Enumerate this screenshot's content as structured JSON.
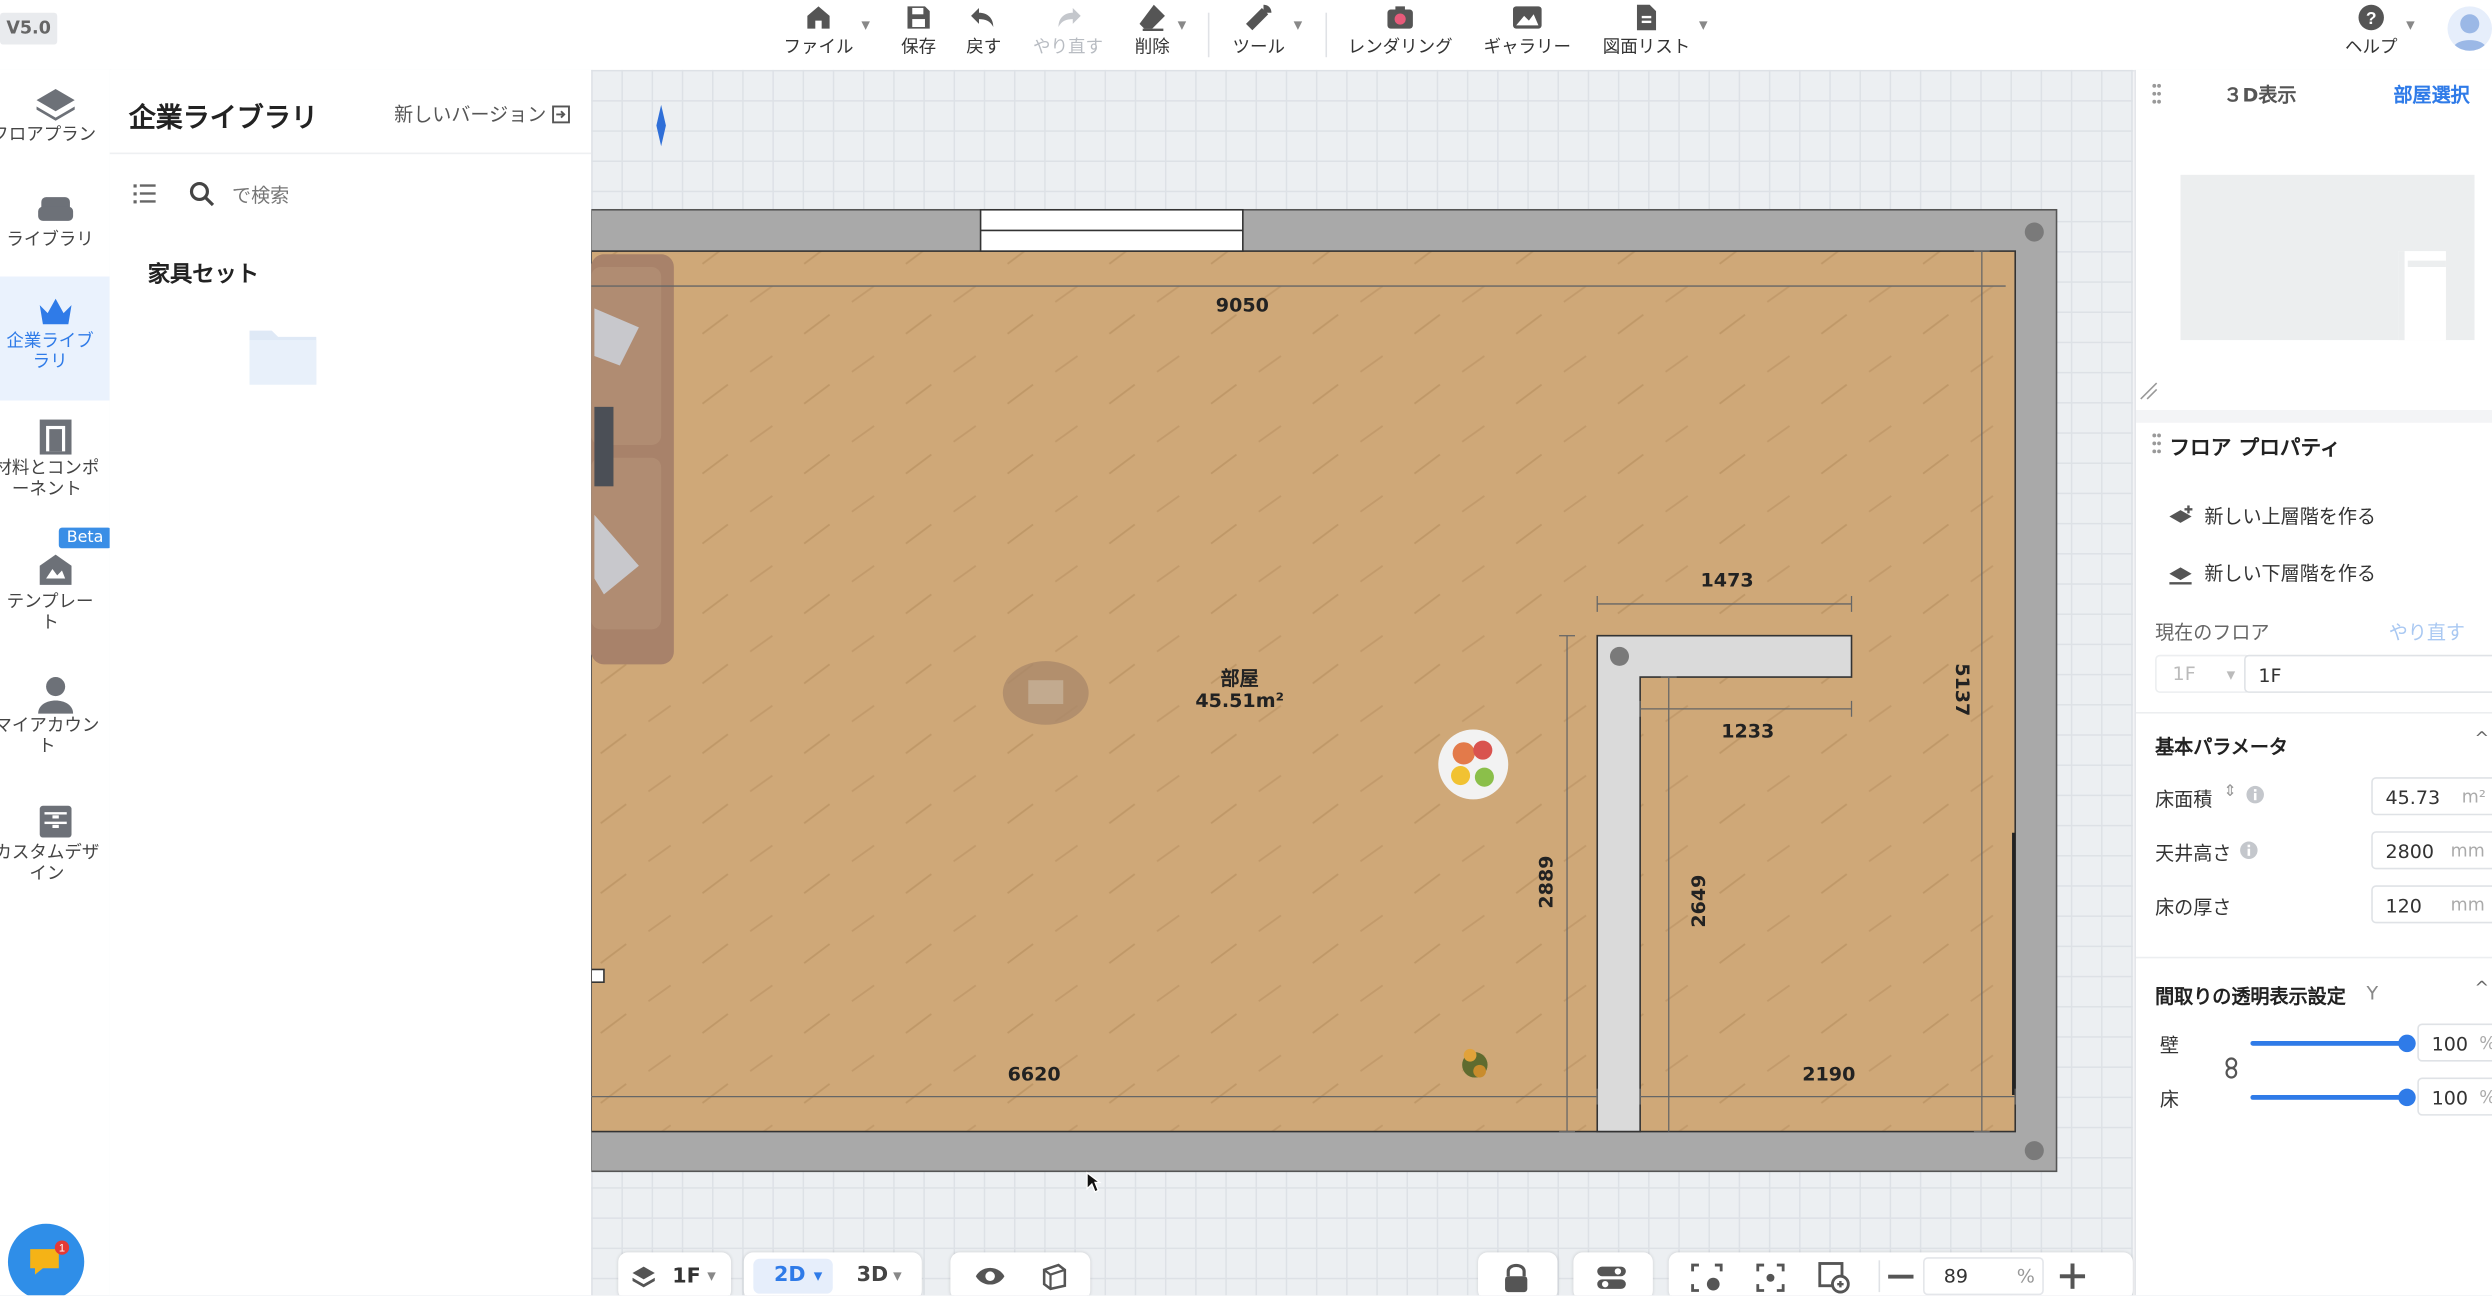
{
  "version": "V5.0",
  "toolbar": {
    "file": "ファイル",
    "save": "保存",
    "undo": "戻す",
    "redo": "やり直す",
    "delete": "削除",
    "tools": "ツール",
    "rendering": "レンダリング",
    "gallery": "ギャラリー",
    "drawing_list": "図面リスト",
    "help": "ヘルプ"
  },
  "nav": {
    "floorplan": "フロアプラン",
    "library": "ライブラリ",
    "enterprise_library": "企業ライブラリ",
    "materials": "材料とコンポーネント",
    "template": "テンプレート",
    "beta": "Beta",
    "my_account": "マイアカウント",
    "custom_design": "カスタムデザイン"
  },
  "library_panel": {
    "title": "企業ライブラリ",
    "new_version": "新しいバージョン",
    "search_placeholder": "で検索",
    "section": "家具セット"
  },
  "plan": {
    "room_name": "部屋",
    "room_area": "45.51m²",
    "dims": {
      "top": "9050",
      "wall_top": "1473",
      "wall_inner": "1233",
      "right": "5137",
      "left_vertical": "2889",
      "inner_vertical": "2649",
      "bottom_left": "6620",
      "bottom_right": "2190"
    }
  },
  "right_panel": {
    "view_3d": "３D表示",
    "room_select": "部屋選択",
    "floor_properties": "フロア プロパティ",
    "new_upper_floor": "新しい上層階を作る",
    "new_lower_floor": "新しい下層階を作る",
    "current_floor_label": "現在のフロア",
    "redo_link": "やり直す",
    "floor_select_value": "1F",
    "floor_name_value": "1F",
    "basic_params": "基本パラメータ",
    "floor_area_label": "床面積",
    "floor_area_value": "45.73",
    "floor_area_unit": "m²",
    "ceiling_height_label": "天井高さ",
    "ceiling_height_value": "2800",
    "floor_thickness_label": "床の厚さ",
    "floor_thickness_value": "120",
    "mm": "mm",
    "transparency_title": "間取りの透明表示設定",
    "transparency_key": "Y",
    "wall_label": "壁",
    "wall_value": "100",
    "wall_level": 100,
    "floor_label": "床",
    "floor_value": "100",
    "floor_level": 100,
    "percent": "%"
  },
  "bottom_bar": {
    "floor": "1F",
    "mode_2d": "2D",
    "mode_3d": "3D",
    "zoom": "89",
    "percent": "%"
  },
  "colors": {
    "accent": "#2f7be8",
    "floor_wood": "#cfa878",
    "wall_gray": "#a9a9a9"
  }
}
